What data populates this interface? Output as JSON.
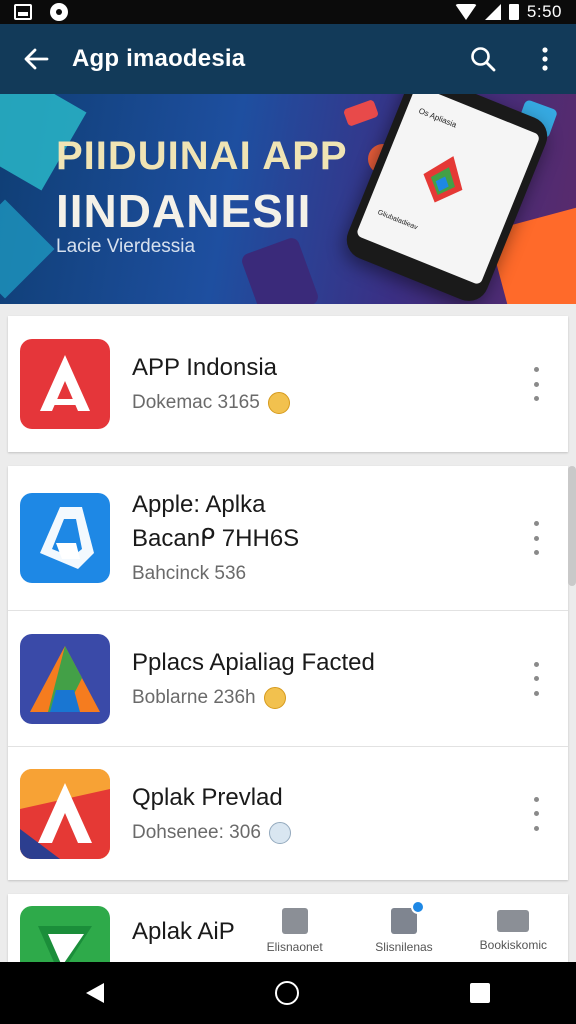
{
  "status_bar": {
    "time": "5:50"
  },
  "app_bar": {
    "title": "Agp imaodesia"
  },
  "banner": {
    "line1": "PIIDUINAI APP",
    "line2": "IINDANESII",
    "subtitle": "Lacie Vierdessia",
    "phone_caption": "Os Apliasia",
    "phone_footer": "Gliubaladieav"
  },
  "featured": {
    "title": "APP Indonsia",
    "subtitle": "Dokemac 3165"
  },
  "apps": [
    {
      "title": "Apple: Aplka",
      "title2": "Bacanᑭ 7HH6S",
      "subtitle": "Bahcinck 536"
    },
    {
      "title": "Pplacs Apialiag  Facted",
      "subtitle": "Boblarne 236h"
    },
    {
      "title": "Qplak Prevlad",
      "subtitle": "Dohsenee: 306"
    }
  ],
  "partial": {
    "title": "Aplak AiP"
  },
  "bottom_tabs": [
    {
      "label": "Elisnaonet"
    },
    {
      "label": "Slisnilenas"
    },
    {
      "label": "Bookiskomic"
    }
  ],
  "colors": {
    "app_bar": "#123a59",
    "status_bar": "#0b0b0b",
    "nav_bar": "#000000"
  }
}
